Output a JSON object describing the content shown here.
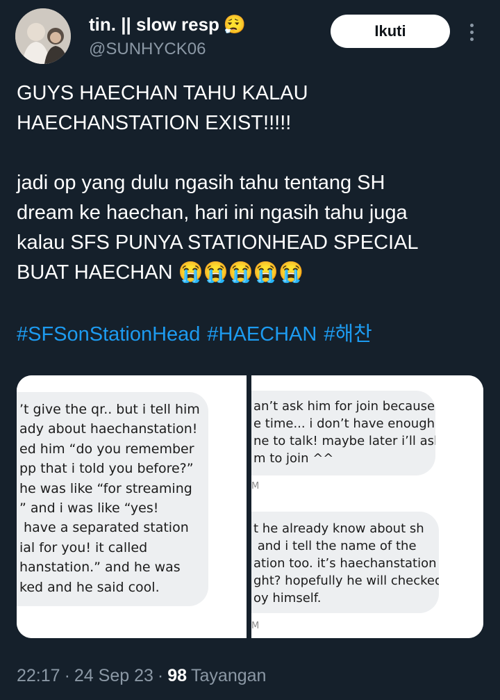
{
  "author": {
    "display_name": "tin. || slow resp",
    "name_emoji": "😮‍💨",
    "handle": "@SUNHYCK06",
    "follow_label": "Ikuti"
  },
  "tweet": {
    "text": "GUYS HAECHAN TAHU KALAU\nHAECHANSTATION EXIST!!!!!\n\njadi op yang dulu ngasih tahu tentang SH\ndream ke haechan, hari ini ngasih tahu juga\nkalau SFS PUNYA STATIONHEAD SPECIAL\nBUAT HAECHAN 😭😭😭😭😭",
    "hashtags": [
      "#SFSonStationHead",
      "#HAECHAN",
      "#해찬"
    ]
  },
  "media": {
    "left_message": "’t give the qr.. but i tell him\nady about haechanstation!\ned him “do you remember\npp that i told you before?”\nhe was like “for streaming\n” and i was like “yes!\n have a separated station\nial for you! it called\nhanstation.” and he was\nked and he said cool.",
    "right_message_1": "an’t ask him for join because\ne time... i don’t have enough\nne to talk! maybe later i’ll ask\nm to join ^^",
    "right_stamp_1": "M",
    "right_message_2": "t he already know about sh\n and i tell the name of the\nation too. it’s haechanstation\nght? hopefully he will checked\noy himself.",
    "right_stamp_2": "M"
  },
  "meta": {
    "time": "22:17",
    "separator": "·",
    "date": "24 Sep 23",
    "views_count": "98",
    "views_label": "Tayangan"
  }
}
